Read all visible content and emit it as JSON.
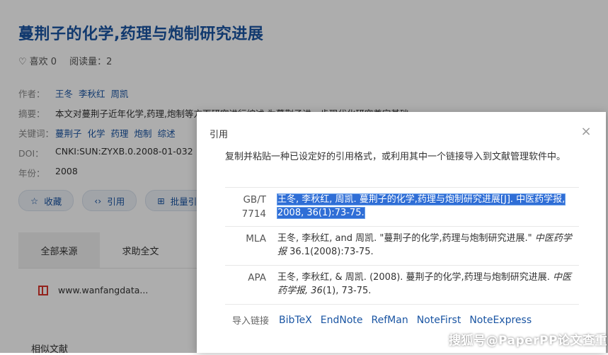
{
  "article": {
    "title": "蔓荆子的化学,药理与炮制研究进展",
    "likes_label": "喜欢 0",
    "reads_label": "阅读量：2",
    "authors_key": "作者：",
    "authors": [
      "王冬",
      "李秋红",
      "周凯"
    ],
    "abstract_key": "摘要：",
    "abstract": "本文对蔓荆子近年化学,药理,炮制等方面研究进行综述,为蔓荆子进一步现代化研究奠定基础",
    "keywords_key": "关键词：",
    "keywords": [
      "蔓荆子",
      "化学",
      "药理",
      "炮制",
      "综述"
    ],
    "doi_key": "DOI：",
    "doi": "CNKI:SUN:ZYXB.0.2008-01-032",
    "year_key": "年份：",
    "year": "2008"
  },
  "actions": {
    "favorite": "收藏",
    "cite": "引用",
    "batch": "批量引"
  },
  "source_tabs": {
    "all": "全部来源",
    "help": "求助全文"
  },
  "source_link": "www.wanfangdata...",
  "related": "相似文献",
  "dialog": {
    "title": "引用",
    "close": "×",
    "instruction": "复制并粘贴一种已设定好的引用格式，或利用其中一个链接导入到文献管理软件中。",
    "citations": [
      {
        "label": "GB/T 7714",
        "text": "王冬, 李秋红, 周凯. 蔓荆子的化学,药理与炮制研究进展[J]. 中医药学报, 2008, 36(1):73-75."
      },
      {
        "label": "MLA",
        "plain": "王冬, 李秋红, and 周凯. \"蔓荆子的化学,药理与炮制研究进展.\" ",
        "italic": "中医药学报",
        "tail": " 36.1(2008):73-75."
      },
      {
        "label": "APA",
        "plain": "王冬, 李秋红, & 周凯. (2008). 蔓荆子的化学,药理与炮制研究进展. ",
        "italic": "中医药学报, 36",
        "tail": "(1), 73-75."
      }
    ],
    "import_label": "导入链接",
    "import_links": [
      "BibTeX",
      "EndNote",
      "RefMan",
      "NoteFirst",
      "NoteExpress"
    ]
  },
  "watermark": "搜狐号@PaperPP论文查重",
  "colors": {
    "link": "#1a55a3",
    "selection": "#2f6ed6",
    "overlay": "rgba(0,0,0,0.32)"
  }
}
